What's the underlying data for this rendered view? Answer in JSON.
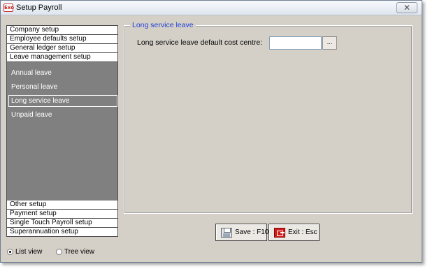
{
  "window": {
    "title": "Setup Payroll",
    "app_icon_text": "Exo",
    "close_glyph": "✕"
  },
  "nav": {
    "top_sections": [
      {
        "label": "Company setup"
      },
      {
        "label": "Employee defaults setup"
      },
      {
        "label": "General ledger setup"
      },
      {
        "label": "Leave management setup"
      }
    ],
    "expanded_items": [
      {
        "label": "Annual leave"
      },
      {
        "label": "Personal leave"
      },
      {
        "label": "Long service leave",
        "selected": true
      },
      {
        "label": "Unpaid leave"
      }
    ],
    "bottom_sections": [
      {
        "label": "Other setup"
      },
      {
        "label": "Payment setup"
      },
      {
        "label": "Single Touch Payroll setup"
      },
      {
        "label": "Superannuation setup"
      }
    ]
  },
  "view_mode": {
    "list_label": "List view",
    "tree_label": "Tree view",
    "selected": "list"
  },
  "panel": {
    "title": "Long service leave",
    "field_label": "Long service leave default cost centre:",
    "field_value": "",
    "browse_label": "..."
  },
  "buttons": {
    "save_label": "Save : F10",
    "exit_label": "Exit : Esc"
  },
  "colors": {
    "window_bg": "#d4d0c8",
    "nav_panel_bg": "#808080",
    "legend_text": "#1f3fd6",
    "exit_icon": "#d21a1a"
  }
}
